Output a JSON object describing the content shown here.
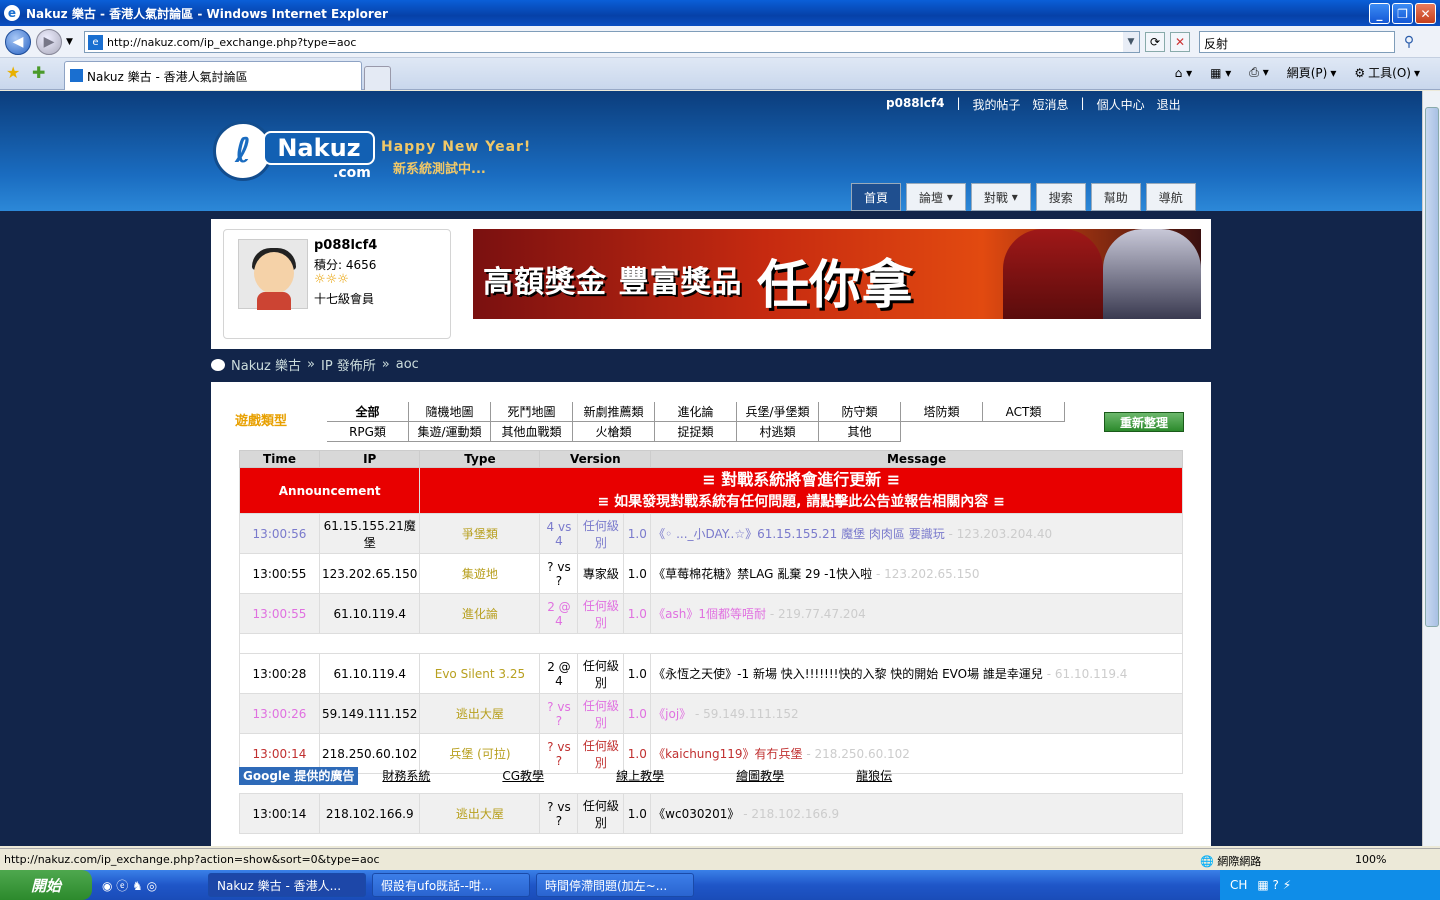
{
  "window": {
    "title": "Nakuz 樂古 - 香港人氣討論區 - Windows Internet Explorer"
  },
  "browser": {
    "url": "http://nakuz.com/ip_exchange.php?type=aoc",
    "search_value": "反射",
    "tab_title": "Nakuz 樂古 - 香港人氣討論區",
    "tools": {
      "page": "網頁(P)",
      "tools": "工具(O)"
    }
  },
  "site": {
    "topnav": {
      "user": "p088lcf4",
      "sep": "|",
      "posts": "我的帖子",
      "messages": "短消息",
      "center": "個人中心",
      "logout": "退出"
    },
    "tagline": "Happy New Year!",
    "tagline2": "新系統測試中...",
    "logo_word": "Nakuz",
    "logo_com": ".com",
    "mainnav": [
      "首頁",
      "論壇",
      "對戰",
      "搜索",
      "幫助",
      "導航"
    ],
    "profile": {
      "name": "p088lcf4",
      "score": "積分: 4656",
      "stars": "☼☼☼",
      "level": "十七級會員"
    },
    "banner": {
      "text": "高額獎金 豐富獎品",
      "big": "任你拿"
    },
    "breadcrumb": [
      "Nakuz 樂古",
      "»",
      "IP 發佈所",
      "»",
      "aoc"
    ]
  },
  "game_types": {
    "label": "遊戲類型",
    "row1": [
      "全部",
      "隨機地圖",
      "死鬥地圖",
      "新劇推薦類",
      "進化論",
      "兵堡/爭堡類",
      "防守類",
      "塔防類",
      "ACT類"
    ],
    "row2": [
      "RPG類",
      "集遊/運動類",
      "其他血戰類",
      "火槍類",
      "捉捉類",
      "村逃類",
      "其他"
    ],
    "refresh": "重新整理"
  },
  "table": {
    "headers": [
      "Time",
      "IP",
      "Type",
      "Version",
      "Message"
    ],
    "announcement": {
      "label": "Announcement",
      "line1": "≡ 對戰系統將會進行更新 ≡",
      "line2": "≡ 如果發現對戰系統有任何問題, 請點擊此公告並報告相關內容 ≡"
    },
    "rows": [
      {
        "time": "13:00:56",
        "ip": "61.15.155.21魔堡",
        "type": "爭堡類",
        "vs": "4 vs 4",
        "level": "任何級別",
        "ver": "1.0",
        "msg": "《◦ ..._小DAY..☆》61.15.155.21 魔堡 肉肉區 要識玩",
        "ghost": "- 123.203.204.40"
      },
      {
        "time": "13:00:55",
        "ip": "123.202.65.150",
        "type": "集遊地",
        "vs": "? vs ?",
        "level": "專家級",
        "ver": "1.0",
        "msg": "《草莓棉花糖》禁LAG 亂棄 29 -1快入啦",
        "ghost": "- 123.202.65.150"
      },
      {
        "time": "13:00:55",
        "ip": "61.10.119.4",
        "type": "進化論",
        "vs": "2 @ 4",
        "level": "任何級別",
        "ver": "1.0",
        "msg": "《ash》1個都等唔耐",
        "ghost": "- 219.77.47.204"
      },
      {
        "time": "13:00:28",
        "ip": "61.10.119.4",
        "type": "Evo Silent 3.25",
        "vs": "2 @ 4",
        "level": "任何級別",
        "ver": "1.0",
        "msg": "《永恆之天使》-1 新場 快入!!!!!!!快的入黎 快的開始 EVO場 誰是幸運兒",
        "ghost": "- 61.10.119.4"
      },
      {
        "time": "13:00:26",
        "ip": "59.149.111.152",
        "type": "逃出大屋",
        "vs": "? vs ?",
        "level": "任何級別",
        "ver": "1.0",
        "msg": "《joj》",
        "ghost": "- 59.149.111.152"
      },
      {
        "time": "13:00:14",
        "ip": "218.250.60.102",
        "type": "兵堡 (可拉)",
        "vs": "? vs ?",
        "level": "任何級別",
        "ver": "1.0",
        "msg": "《kaichung119》有冇兵堡",
        "ghost": "- 218.250.60.102"
      },
      {
        "time": "13:00:14",
        "ip": "218.102.166.9",
        "type": "逃出大屋",
        "vs": "? vs ?",
        "level": "任何級別",
        "ver": "1.0",
        "msg": "《wc030201》",
        "ghost": "- 218.102.166.9"
      }
    ],
    "ads": {
      "google": "Google 提供的廣告",
      "links": [
        "財務系統",
        "CG教學",
        "線上教學",
        "繪圖教學",
        "龍狼伝"
      ]
    }
  },
  "status": {
    "url": "http://nakuz.com/ip_exchange.php?action=show&sort=0&type=aoc",
    "zone": "網際網路",
    "zoom": "100%"
  },
  "taskbar": {
    "start": "開始",
    "tasks": [
      "Nakuz 樂古 - 香港人...",
      "假設有ufo既話--咁...",
      "時間停滯問題(加左~..."
    ],
    "tray": "CH"
  }
}
